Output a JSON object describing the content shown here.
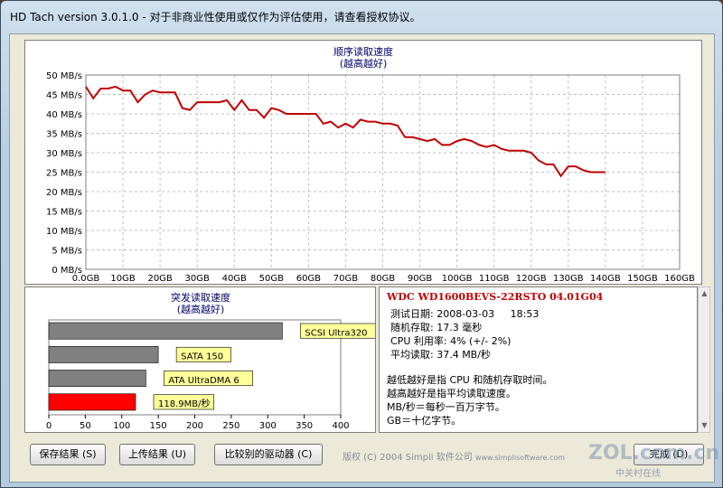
{
  "window": {
    "title": "HD Tach version 3.0.1.0  - 对于非商业性使用或仅作为评估使用，请查看授权协议。"
  },
  "chart_data": [
    {
      "type": "line",
      "title": "顺序读取速度",
      "subtitle": "(越高越好)",
      "xlabel": "",
      "ylabel": "",
      "x_ticks": [
        "0.0GB",
        "10GB",
        "20GB",
        "30GB",
        "40GB",
        "50GB",
        "60GB",
        "70GB",
        "80GB",
        "90GB",
        "100GB",
        "110GB",
        "120GB",
        "130GB",
        "140GB",
        "150GB",
        "160GB"
      ],
      "y_ticks": [
        "0 MB/s",
        "5 MB/s",
        "10 MB/s",
        "15 MB/s",
        "20 MB/s",
        "25 MB/s",
        "30 MB/s",
        "35 MB/s",
        "40 MB/s",
        "45 MB/s",
        "50 MB/s"
      ],
      "xlim": [
        0,
        160
      ],
      "ylim": [
        0,
        50
      ],
      "grid": true,
      "color": "#c00000",
      "x": [
        0,
        2,
        4,
        6,
        8,
        10,
        12,
        14,
        16,
        18,
        20,
        22,
        24,
        26,
        28,
        30,
        32,
        34,
        36,
        38,
        40,
        42,
        44,
        46,
        48,
        50,
        52,
        54,
        56,
        58,
        60,
        62,
        64,
        66,
        68,
        70,
        72,
        74,
        76,
        78,
        80,
        82,
        84,
        86,
        88,
        90,
        92,
        94,
        96,
        98,
        100,
        102,
        104,
        106,
        108,
        110,
        112,
        114,
        116,
        118,
        120,
        122,
        124,
        126,
        128,
        130,
        132,
        134,
        136,
        138,
        140,
        142,
        144,
        146,
        148,
        150,
        152,
        154,
        156,
        158,
        160
      ],
      "values": [
        47,
        44,
        46.5,
        46.5,
        47,
        46,
        46,
        43,
        45,
        46,
        45.5,
        45.5,
        45.5,
        41.5,
        41,
        43,
        43,
        43,
        43,
        43.5,
        41,
        43.5,
        41,
        41,
        39,
        41.5,
        41,
        40,
        40,
        40,
        40,
        40,
        37.5,
        38,
        36.5,
        37.5,
        36.5,
        38.5,
        38,
        38,
        37.5,
        37.5,
        37,
        34,
        34,
        33.5,
        33,
        33.5,
        32,
        32,
        33,
        33.5,
        33,
        32,
        31.5,
        32,
        31,
        30.5,
        30.5,
        30.5,
        30,
        28,
        27,
        27,
        24,
        26.5,
        26.5,
        25.5,
        25,
        25,
        25
      ]
    },
    {
      "type": "bar",
      "title": "突发读取速度",
      "subtitle": "(越高越好)",
      "categories": [
        "SCSI Ultra320",
        "SATA 150",
        "ATA UltraDMA 6",
        "118.9MB/秒"
      ],
      "values": [
        320,
        150,
        133,
        118.9
      ],
      "colors": [
        "#808080",
        "#808080",
        "#808080",
        "#ff0000"
      ],
      "x_ticks": [
        "0",
        "50",
        "100",
        "150",
        "200",
        "250",
        "300",
        "350",
        "400"
      ],
      "xlim": [
        0,
        400
      ],
      "label_bg": "#ffff99"
    }
  ],
  "info": {
    "drive": "WDC WD1600BEVS-22RSTO 04.01G04",
    "lines": [
      "测试日期: 2008-03-03     18:53",
      "随机存取: 17.3 毫秒",
      "CPU 利用率: 4% (+/- 2%)",
      "平均读取: 37.4 MB/秒"
    ],
    "notes": [
      "越低越好是指 CPU 和随机存取时间。",
      "越高越好是指平均读取速度。",
      "MB/秒＝每秒一百万字节。",
      "GB＝十亿字节。"
    ]
  },
  "buttons": {
    "save": "保存结果 (S)",
    "upload": "上传结果 (U)",
    "compare": "比较别的驱动器 (C)",
    "done": "完成 (D)"
  },
  "footer": {
    "copyright": "版权 (C) 2004 Simpli 软件公司",
    "url": "www.simplisoftware.com"
  },
  "watermark": {
    "main": "ZOL.com.cn",
    "sub": "中关村在线"
  }
}
